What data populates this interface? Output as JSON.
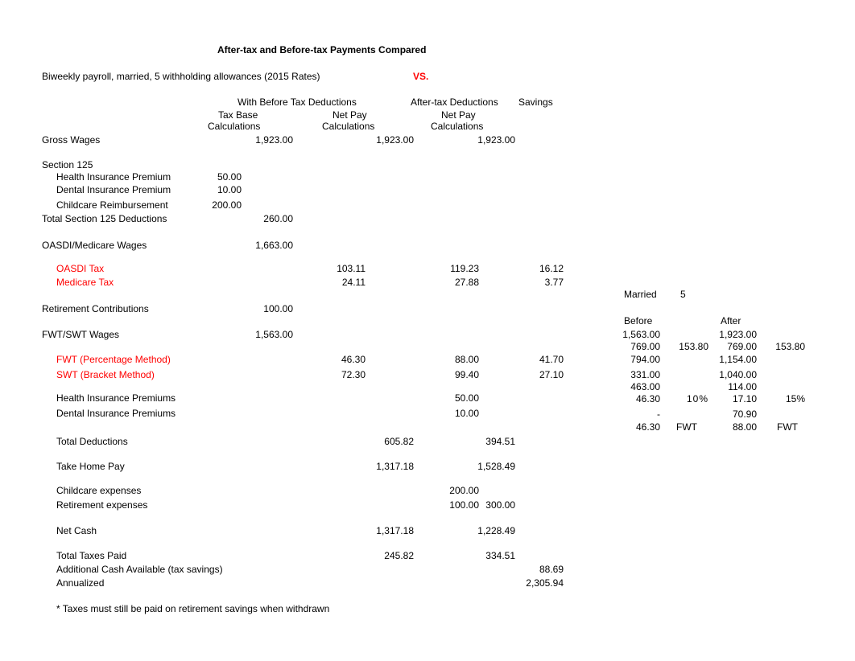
{
  "title": "After-tax and Before-tax Payments Compared",
  "subtitle": "Biweekly payroll, married, 5 withholding allowances (2015 Rates)",
  "vs": "VS.",
  "headers": {
    "before": "With Before Tax Deductions",
    "taxbase1": "Tax Base",
    "calcs": "Calculations",
    "netpay": "Net Pay",
    "after": "After-tax Deductions",
    "savings": "Savings"
  },
  "labels": {
    "gross": "Gross Wages",
    "sec125": "Section 125",
    "health": "Health Insurance Premium",
    "dental": "Dental Insurance Premium",
    "childcare": "Childcare Reimbursement",
    "tot125": "Total Section 125 Deductions",
    "oasdiWages": "OASDI/Medicare Wages",
    "oasdiTax": "OASDI Tax",
    "mediTax": "Medicare Tax",
    "retire": "Retirement Contributions",
    "fwtswt": "FWT/SWT Wages",
    "fwt": "FWT (Percentage Method)",
    "swt": "SWT (Bracket Method)",
    "health2": "Health Insurance Premiums",
    "dental2": "Dental Insurance Premiums",
    "totded": "Total Deductions",
    "takehome": "Take Home Pay",
    "childexp": "Childcare expenses",
    "retireexp": "Retirement expenses",
    "netcash": "Net Cash",
    "tottax": "Total Taxes Paid",
    "addcash": "Additional Cash Available (tax savings)",
    "annual": "Annualized"
  },
  "vals": {
    "gross_c2": "1,923.00",
    "gross_c4": "1,923.00",
    "gross_c6": "1,923.00",
    "health_c1": "50.00",
    "dental_c1": "10.00",
    "child_c1": "200.00",
    "tot125_c2": "260.00",
    "oasdiW_c2": "1,663.00",
    "oasdiT_c3": "103.11",
    "oasdiT_c5": "119.23",
    "oasdiT_c7": "16.12",
    "mediT_c3": "24.11",
    "mediT_c5": "27.88",
    "mediT_c7": "3.77",
    "retire_c2": "100.00",
    "fwtswt_c2": "1,563.00",
    "fwt_c3": "46.30",
    "fwt_c5": "88.00",
    "fwt_c7": "41.70",
    "swt_c3": "72.30",
    "swt_c5": "99.40",
    "swt_c7": "27.10",
    "health2_c5": "50.00",
    "dental2_c5": "10.00",
    "totded_c4": "605.82",
    "totded_c6": "394.51",
    "takehome_c4": "1,317.18",
    "takehome_c6": "1,528.49",
    "childexp_c5": "200.00",
    "retireexp_c5": "100.00",
    "retireexp_c6": "300.00",
    "netcash_c4": "1,317.18",
    "netcash_c6": "1,228.49",
    "tottax_c4": "245.82",
    "tottax_c6": "334.51",
    "addcash_c7": "88.69",
    "annual_c7": "2,305.94"
  },
  "side": {
    "married": "Married",
    "five": "5",
    "before": "Before",
    "after": "After",
    "r1c1": "1,563.00",
    "r1c3": "1,923.00",
    "r2c1": "769.00",
    "r2c2": "153.80",
    "r2c3": "769.00",
    "r2c4": "153.80",
    "r3c1": "794.00",
    "r3c3": "1,154.00",
    "r4c1": "331.00",
    "r4c3": "1,040.00",
    "r5c1": "463.00",
    "r5c3": "114.00",
    "r6c1": "46.30",
    "r6c2": "10%",
    "r6c3": "17.10",
    "r6c4": "15%",
    "r7c1": "-",
    "r7c3": "70.90",
    "r8c1": "46.30",
    "r8c2": "FWT",
    "r8c3": "88.00",
    "r8c4": "FWT"
  },
  "footnote": "*  Taxes must still be paid on retirement savings when withdrawn"
}
